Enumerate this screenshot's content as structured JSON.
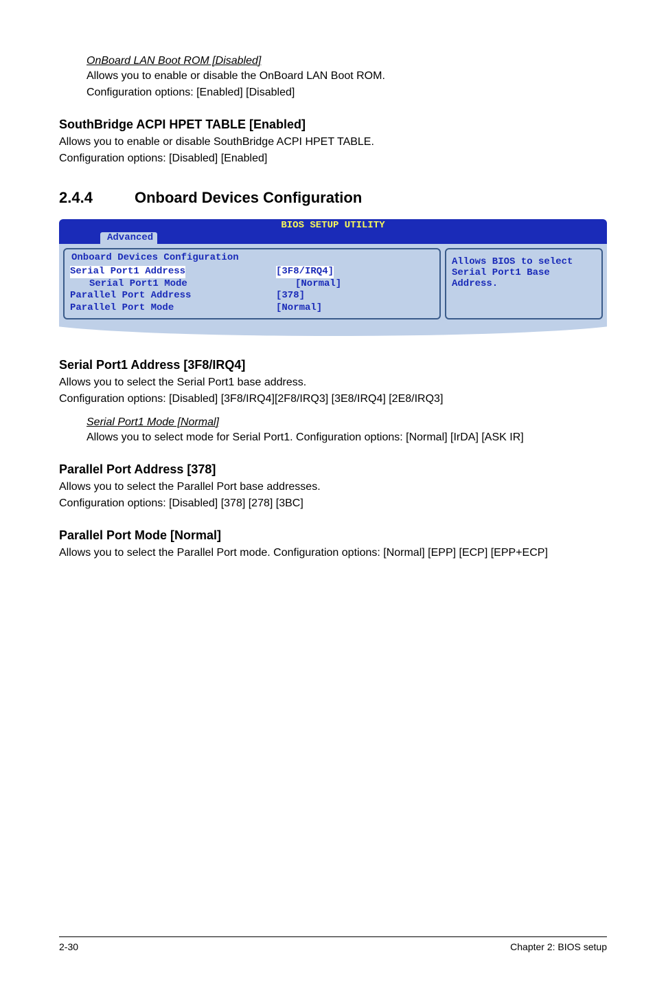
{
  "section1": {
    "subheading": "OnBoard LAN Boot ROM [Disabled]",
    "line1": "Allows you to enable or disable the OnBoard LAN Boot ROM.",
    "line2": "Configuration options: [Enabled] [Disabled]"
  },
  "section2": {
    "heading": "SouthBridge ACPI HPET TABLE [Enabled]",
    "line1": "Allows you to enable or disable SouthBridge ACPI HPET TABLE.",
    "line2": "Configuration options: [Disabled] [Enabled]"
  },
  "main_section": {
    "num": "2.4.4",
    "title": "Onboard Devices Configuration"
  },
  "bios": {
    "title": "BIOS SETUP UTILITY",
    "tab": "Advanced",
    "group_title": "Onboard Devices Configuration",
    "rows": [
      {
        "label": "Serial Port1 Address",
        "value": "[3F8/IRQ4]",
        "selected": true,
        "sub": false
      },
      {
        "label": "Serial Port1 Mode",
        "value": "[Normal]",
        "selected": false,
        "sub": true
      },
      {
        "label": "Parallel Port Address",
        "value": "[378]",
        "selected": false,
        "sub": false
      },
      {
        "label": "Parallel Port Mode",
        "value": "[Normal]",
        "selected": false,
        "sub": false
      }
    ],
    "help": "Allows BIOS to select Serial Port1 Base Address."
  },
  "section3": {
    "heading": "Serial Port1 Address [3F8/IRQ4]",
    "line1": "Allows you to select the Serial Port1 base address.",
    "line2": "Configuration options: [Disabled] [3F8/IRQ4][2F8/IRQ3] [3E8/IRQ4] [2E8/IRQ3]",
    "subheading": "Serial Port1 Mode [Normal]",
    "subline": "Allows you to select mode for Serial Port1. Configuration options: [Normal] [IrDA] [ASK IR]"
  },
  "section4": {
    "heading": "Parallel Port Address [378]",
    "line1": "Allows you to select the Parallel Port base addresses.",
    "line2": "Configuration options: [Disabled] [378] [278] [3BC]"
  },
  "section5": {
    "heading": "Parallel Port Mode [Normal]",
    "line1": "Allows you to select the Parallel Port  mode. Configuration options: [Normal] [EPP] [ECP] [EPP+ECP]"
  },
  "footer": {
    "left": "2-30",
    "right": "Chapter 2: BIOS setup"
  }
}
